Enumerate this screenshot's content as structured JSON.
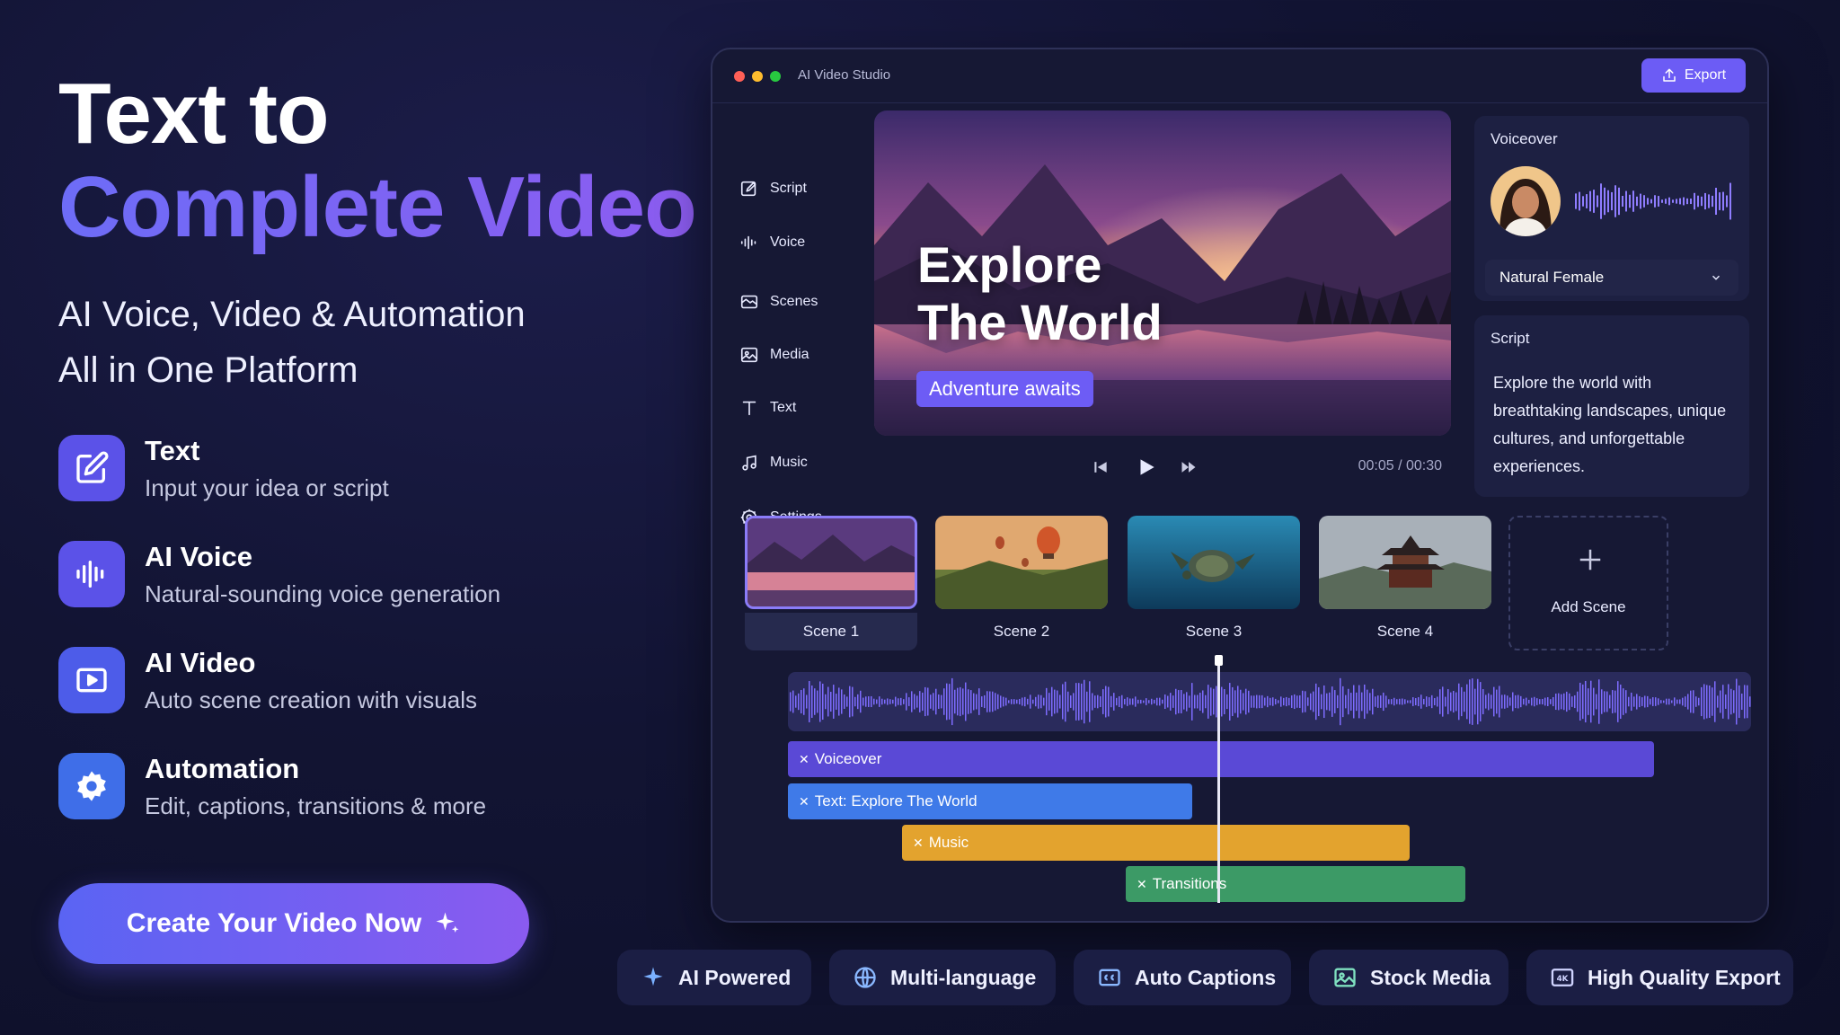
{
  "hero": {
    "title_line1": "Text to",
    "title_line2": "Complete Video",
    "subtitle_line1": "AI Voice, Video & Automation",
    "subtitle_line2": "All in One Platform"
  },
  "features": [
    {
      "title": "Text",
      "desc": "Input your idea or script",
      "icon": "edit-icon"
    },
    {
      "title": "AI Voice",
      "desc": "Natural-sounding voice generation",
      "icon": "waveform-icon"
    },
    {
      "title": "AI Video",
      "desc": "Auto scene creation with visuals",
      "icon": "video-play-icon"
    },
    {
      "title": "Automation",
      "desc": "Edit, captions, transitions & more",
      "icon": "gear-icon"
    }
  ],
  "cta": {
    "label": "Create Your Video Now",
    "icon": "sparkle-icon"
  },
  "window": {
    "title": "AI Video Studio",
    "export_label": "Export",
    "nav": [
      "Script",
      "Voice",
      "Scenes",
      "Media",
      "Text",
      "Music",
      "Settings"
    ],
    "preview": {
      "title_line1": "Explore",
      "title_line2": "The World",
      "tag": "Adventure awaits",
      "timecode": "00:05 / 00:30"
    },
    "voiceover": {
      "header": "Voiceover",
      "voice": "Natural Female"
    },
    "script": {
      "header": "Script",
      "text": "Explore the world with breathtaking landscapes, unique cultures, and unforgettable experiences."
    },
    "scenes": [
      "Scene 1",
      "Scene 2",
      "Scene 3",
      "Scene 4"
    ],
    "add_scene": "Add Scene",
    "tracks": {
      "voiceover": "Voiceover",
      "text": "Text: Explore The World",
      "music": "Music",
      "transitions": "Transitions"
    }
  },
  "badges": [
    "AI Powered",
    "Multi-language",
    "Auto Captions",
    "Stock Media",
    "High Quality Export"
  ],
  "colors": {
    "accent": "#6c5cf5",
    "text_track": "#3f7ae8",
    "music_track": "#e3a32e",
    "transitions_track": "#3c9a66",
    "voice_track": "#5a49d6"
  }
}
